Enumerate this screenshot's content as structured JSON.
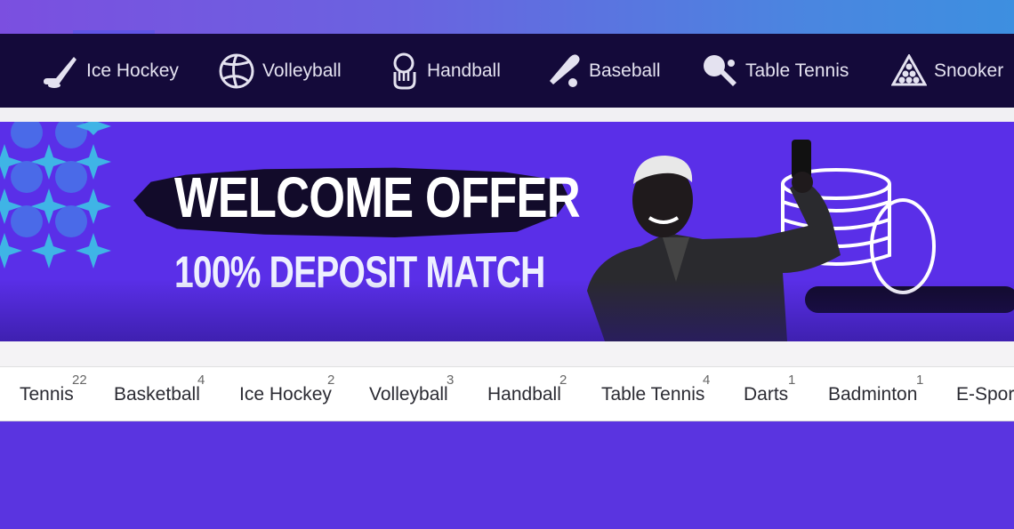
{
  "nav": {
    "items": [
      {
        "label": "Ice Hockey",
        "icon": "hockey-stick-icon"
      },
      {
        "label": "Volleyball",
        "icon": "volleyball-icon"
      },
      {
        "label": "Handball",
        "icon": "handball-icon"
      },
      {
        "label": "Baseball",
        "icon": "baseball-bat-icon"
      },
      {
        "label": "Table Tennis",
        "icon": "ping-pong-icon"
      },
      {
        "label": "Snooker",
        "icon": "snooker-rack-icon"
      }
    ]
  },
  "banner": {
    "headline": "WELCOME OFFER",
    "subheadline": "100% DEPOSIT MATCH"
  },
  "sports_tabs": [
    {
      "label": "Tennis",
      "count": "22"
    },
    {
      "label": "Basketball",
      "count": "4"
    },
    {
      "label": "Ice Hockey",
      "count": "2"
    },
    {
      "label": "Volleyball",
      "count": "3"
    },
    {
      "label": "Handball",
      "count": "2"
    },
    {
      "label": "Table Tennis",
      "count": "4"
    },
    {
      "label": "Darts",
      "count": "1"
    },
    {
      "label": "Badminton",
      "count": "1"
    },
    {
      "label": "E-Sport",
      "count": ""
    }
  ],
  "colors": {
    "nav_background": "#140a3a",
    "banner_background": "#5a2fe8",
    "accent": "#5f55e6"
  }
}
